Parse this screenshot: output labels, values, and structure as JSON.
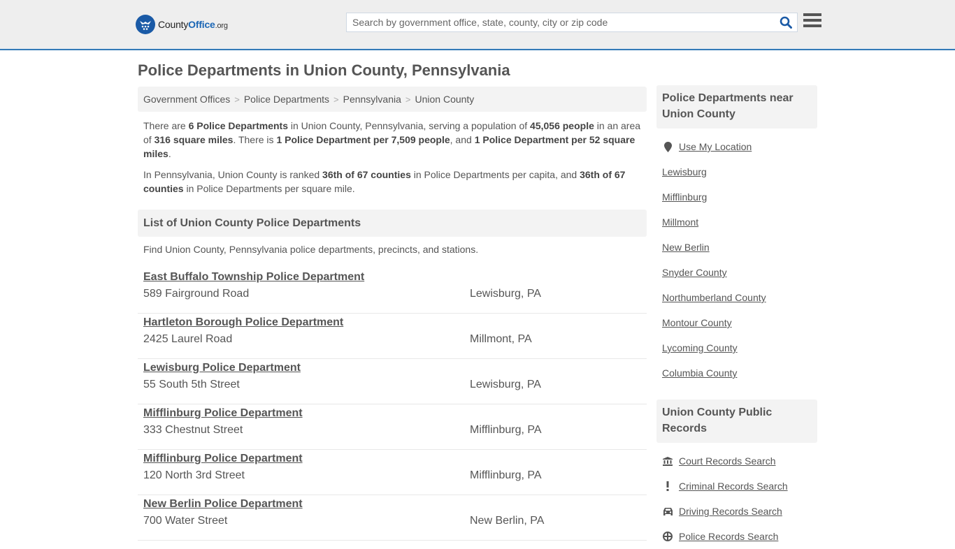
{
  "header": {
    "logo": {
      "name_part1": "County",
      "name_part2": "Office",
      "tld": ".org"
    },
    "search": {
      "placeholder": "Search by government office, state, county, city or zip code",
      "value": ""
    },
    "search_icon": "search-icon",
    "menu_icon": "hamburger-menu-icon",
    "accent_color": "#337ab7"
  },
  "page": {
    "title": "Police Departments in Union County, Pennsylvania"
  },
  "breadcrumb": [
    {
      "label": "Government Offices"
    },
    {
      "label": "Police Departments"
    },
    {
      "label": "Pennsylvania"
    },
    {
      "label": "Union County"
    }
  ],
  "breadcrumb_separator": ">",
  "intro": {
    "p1": {
      "t1": "There are ",
      "b1": "6 Police Departments",
      "t2": " in Union County, Pennsylvania, serving a population of ",
      "b2": "45,056 people",
      "t3": " in an area of ",
      "b3": "316 square miles",
      "t4": ". There is ",
      "b4": "1 Police Department per 7,509 people",
      "t5": ", and ",
      "b5": "1 Police Department per 52 square miles",
      "t6": "."
    },
    "p2": {
      "t1": "In Pennsylvania, Union County is ranked ",
      "b1": "36th of 67 counties",
      "t2": " in Police Departments per capita, and ",
      "b2": "36th of 67 counties",
      "t3": " in Police Departments per square mile."
    }
  },
  "list_section": {
    "heading": "List of Union County Police Departments",
    "description": "Find Union County, Pennsylvania police departments, precincts, and stations.",
    "items": [
      {
        "name": "East Buffalo Township Police Department",
        "address": "589 Fairground Road",
        "city": "Lewisburg, PA"
      },
      {
        "name": "Hartleton Borough Police Department",
        "address": "2425 Laurel Road",
        "city": "Millmont, PA"
      },
      {
        "name": "Lewisburg Police Department",
        "address": "55 South 5th Street",
        "city": "Lewisburg, PA"
      },
      {
        "name": "Mifflinburg Police Department",
        "address": "333 Chestnut Street",
        "city": "Mifflinburg, PA"
      },
      {
        "name": "Mifflinburg Police Department",
        "address": "120 North 3rd Street",
        "city": "Mifflinburg, PA"
      },
      {
        "name": "New Berlin Police Department",
        "address": "700 Water Street",
        "city": "New Berlin, PA"
      }
    ]
  },
  "sidebar": {
    "nearby": {
      "heading": "Police Departments near Union County",
      "use_location": {
        "label": "Use My Location",
        "icon": "map-marker-icon"
      },
      "links": [
        {
          "label": "Lewisburg"
        },
        {
          "label": "Mifflinburg"
        },
        {
          "label": "Millmont"
        },
        {
          "label": "New Berlin"
        },
        {
          "label": "Snyder County"
        },
        {
          "label": "Northumberland County"
        },
        {
          "label": "Montour County"
        },
        {
          "label": "Lycoming County"
        },
        {
          "label": "Columbia County"
        }
      ]
    },
    "records": {
      "heading": "Union County Public Records",
      "links": [
        {
          "label": "Court Records Search",
          "icon": "courthouse-icon"
        },
        {
          "label": "Criminal Records Search",
          "icon": "exclamation-icon"
        },
        {
          "label": "Driving Records Search",
          "icon": "car-icon"
        },
        {
          "label": "Police Records Search",
          "icon": "police-badge-icon"
        }
      ]
    }
  }
}
